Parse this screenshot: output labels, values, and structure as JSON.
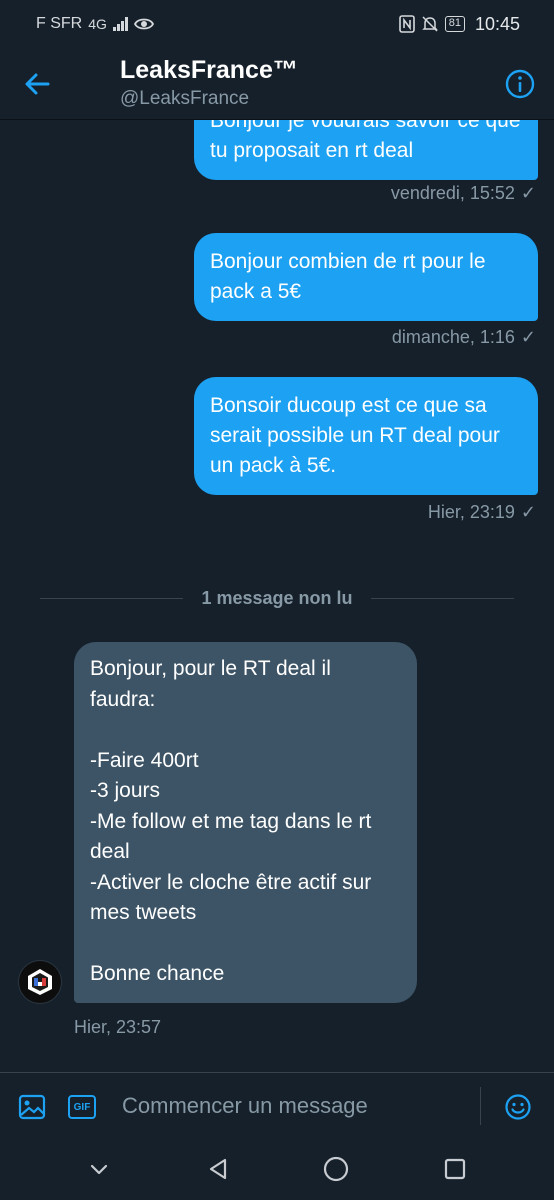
{
  "status_bar": {
    "carrier": "F SFR",
    "network": "4G",
    "battery": "81",
    "time": "10:45"
  },
  "header": {
    "title": "LeaksFrance™",
    "handle": "@LeaksFrance",
    "back_icon": "arrow-left-icon",
    "info_icon": "info-icon"
  },
  "messages": [
    {
      "text": "Bonjour je voudrais savoir ce que tu proposait en rt deal",
      "timestamp": "vendredi, 15:52"
    },
    {
      "text": "Bonjour combien de rt pour le pack a 5€",
      "timestamp": "dimanche, 1:16"
    },
    {
      "text": "Bonsoir ducoup est ce que sa serait possible un RT deal pour un pack à 5€.",
      "timestamp": "Hier, 23:19"
    }
  ],
  "unread_divider": "1 message non lu",
  "incoming": {
    "lines": [
      "Bonjour, pour le RT deal il faudra:",
      "",
      "-Faire 400rt",
      "-3 jours",
      "-Me follow et me tag dans le rt deal",
      "-Activer le cloche être actif sur mes tweets",
      "",
      "Bonne chance"
    ],
    "timestamp": "Hier, 23:57"
  },
  "composer": {
    "placeholder": "Commencer un message",
    "gif_label": "GIF"
  },
  "colors": {
    "background": "#15202b",
    "accent": "#1da1f2",
    "incoming_bubble": "#3d5466",
    "muted_text": "#8899a6"
  }
}
